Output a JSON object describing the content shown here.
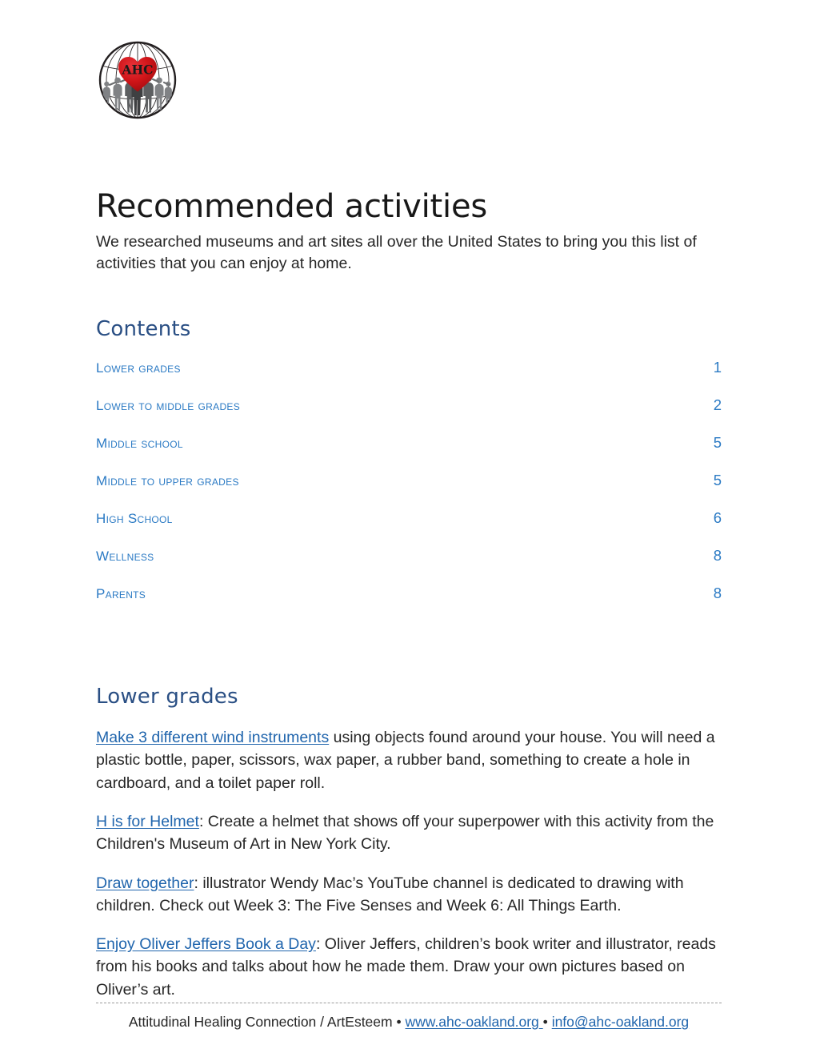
{
  "logo": {
    "alt_name": "ahc-logo",
    "monogram": "AHC",
    "heart_color": "#d01317",
    "figure_color": "#808285",
    "globe_color": "#231f20"
  },
  "header": {
    "title": "Recommended activities",
    "subtitle": "We researched museums and art sites all over the United States to bring you this list of activities that you can enjoy at home."
  },
  "contents": {
    "heading": "Contents",
    "entries": [
      {
        "label": "Lower grades",
        "page": "1"
      },
      {
        "label": "Lower to middle grades",
        "page": "2"
      },
      {
        "label": "Middle school",
        "page": "5"
      },
      {
        "label": "Middle to upper grades",
        "page": "5"
      },
      {
        "label": "High School",
        "page": "6"
      },
      {
        "label": "Wellness",
        "page": "8"
      },
      {
        "label": "Parents",
        "page": "8"
      }
    ]
  },
  "section": {
    "heading": "Lower grades",
    "paragraphs": [
      {
        "link_text": "Make 3 different wind instruments",
        "rest": " using objects found around your house. You will need a plastic bottle, paper, scissors, wax paper, a rubber band, something to create a hole in cardboard, and a toilet paper roll."
      },
      {
        "link_text": "H is for Helmet",
        "rest": ": Create a helmet that shows off your superpower with this activity from the Children's Museum of Art in New York City."
      },
      {
        "link_text": "Draw together",
        "rest": ": illustrator Wendy Mac’s YouTube channel is dedicated to drawing with children. Check out Week 3: The Five Senses and Week 6: All Things Earth."
      },
      {
        "link_text": "Enjoy Oliver Jeffers Book a Day",
        "rest": ": Oliver Jeffers, children’s book writer and illustrator, reads from his books and talks about how he made them. Draw your own pictures based on Oliver’s art."
      }
    ]
  },
  "footer": {
    "organization": "Attitudinal Healing Connection / ArtEsteem",
    "separator": "•",
    "website": "www.ahc-oakland.org",
    "email": "info@ahc-oakland.org"
  },
  "colors": {
    "heading_navy": "#2a4f84",
    "toc_blue": "#2b7ac4",
    "link_blue": "#2065ad",
    "body_text": "#262626"
  }
}
